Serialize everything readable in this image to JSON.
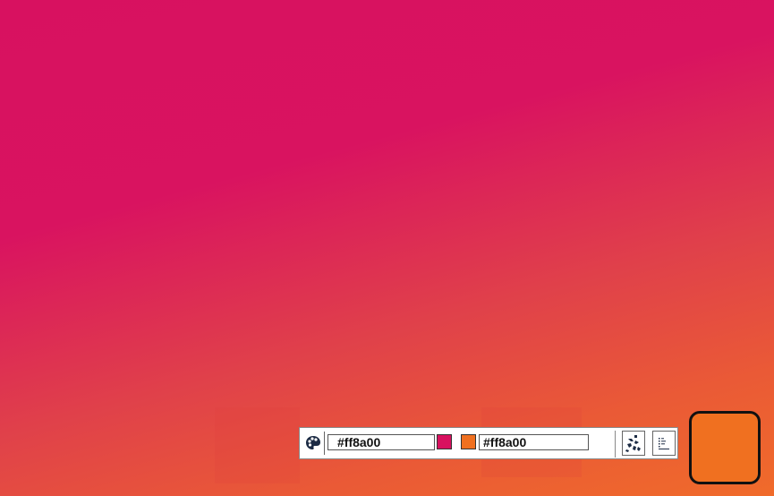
{
  "colors": {
    "start": "#d8115f",
    "end": "#f07020"
  },
  "toolbar": {
    "start_value": "#ff8a00",
    "end_value": "#ff8a00",
    "icons": {
      "palette": "palette-icon",
      "random": "shuffle-icon",
      "list": "list-icon"
    }
  }
}
